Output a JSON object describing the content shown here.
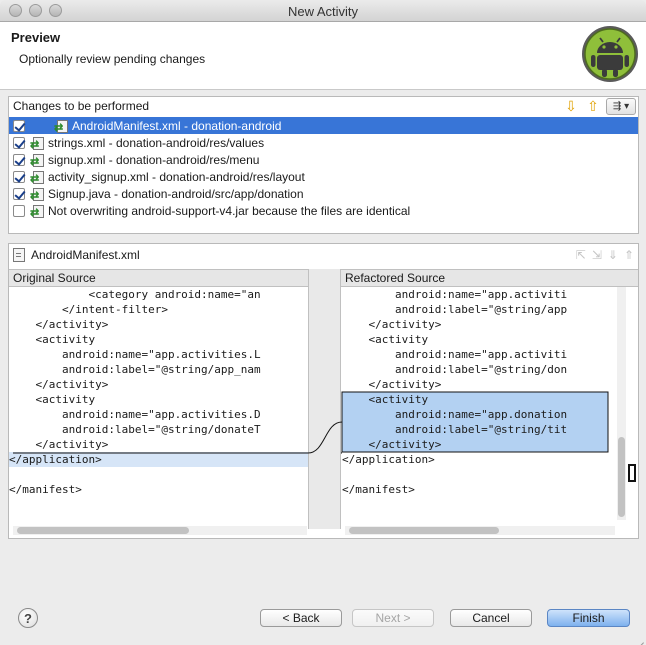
{
  "window": {
    "title": "New Activity"
  },
  "header": {
    "title": "Preview",
    "subtitle": "Optionally review pending changes"
  },
  "changes": {
    "title": "Changes to be performed",
    "items": [
      {
        "checked": true,
        "selected": true,
        "label": "AndroidManifest.xml - donation-android"
      },
      {
        "checked": true,
        "selected": false,
        "label": "strings.xml - donation-android/res/values"
      },
      {
        "checked": true,
        "selected": false,
        "label": "signup.xml - donation-android/res/menu"
      },
      {
        "checked": true,
        "selected": false,
        "label": "activity_signup.xml - donation-android/res/layout"
      },
      {
        "checked": true,
        "selected": false,
        "label": "Signup.java - donation-android/src/app/donation"
      },
      {
        "checked": false,
        "selected": false,
        "label": "Not overwriting android-support-v4.jar because the files are identical"
      }
    ]
  },
  "compare": {
    "file": "AndroidManifest.xml",
    "left": {
      "header": "Original Source",
      "lines": [
        "            <category android:name=\"an",
        "        </intent-filter>",
        "    </activity>",
        "    <activity",
        "        android:name=\"app.activities.L",
        "        android:label=\"@string/app_nam",
        "    </activity>",
        "    <activity",
        "        android:name=\"app.activities.D",
        "        android:label=\"@string/donateT",
        "    </activity>",
        "</application>",
        "",
        "</manifest>"
      ]
    },
    "right": {
      "header": "Refactored Source",
      "lines": [
        "        android:name=\"app.activiti",
        "        android:label=\"@string/app",
        "    </activity>",
        "    <activity",
        "        android:name=\"app.activiti",
        "        android:label=\"@string/don",
        "    </activity>",
        "    <activity",
        "        android:name=\"app.donation",
        "        android:label=\"@string/tit",
        "    </activity>",
        "</application>",
        "",
        "</manifest>"
      ]
    }
  },
  "buttons": {
    "help": "?",
    "back": "< Back",
    "next": "Next >",
    "cancel": "Cancel",
    "finish": "Finish"
  }
}
